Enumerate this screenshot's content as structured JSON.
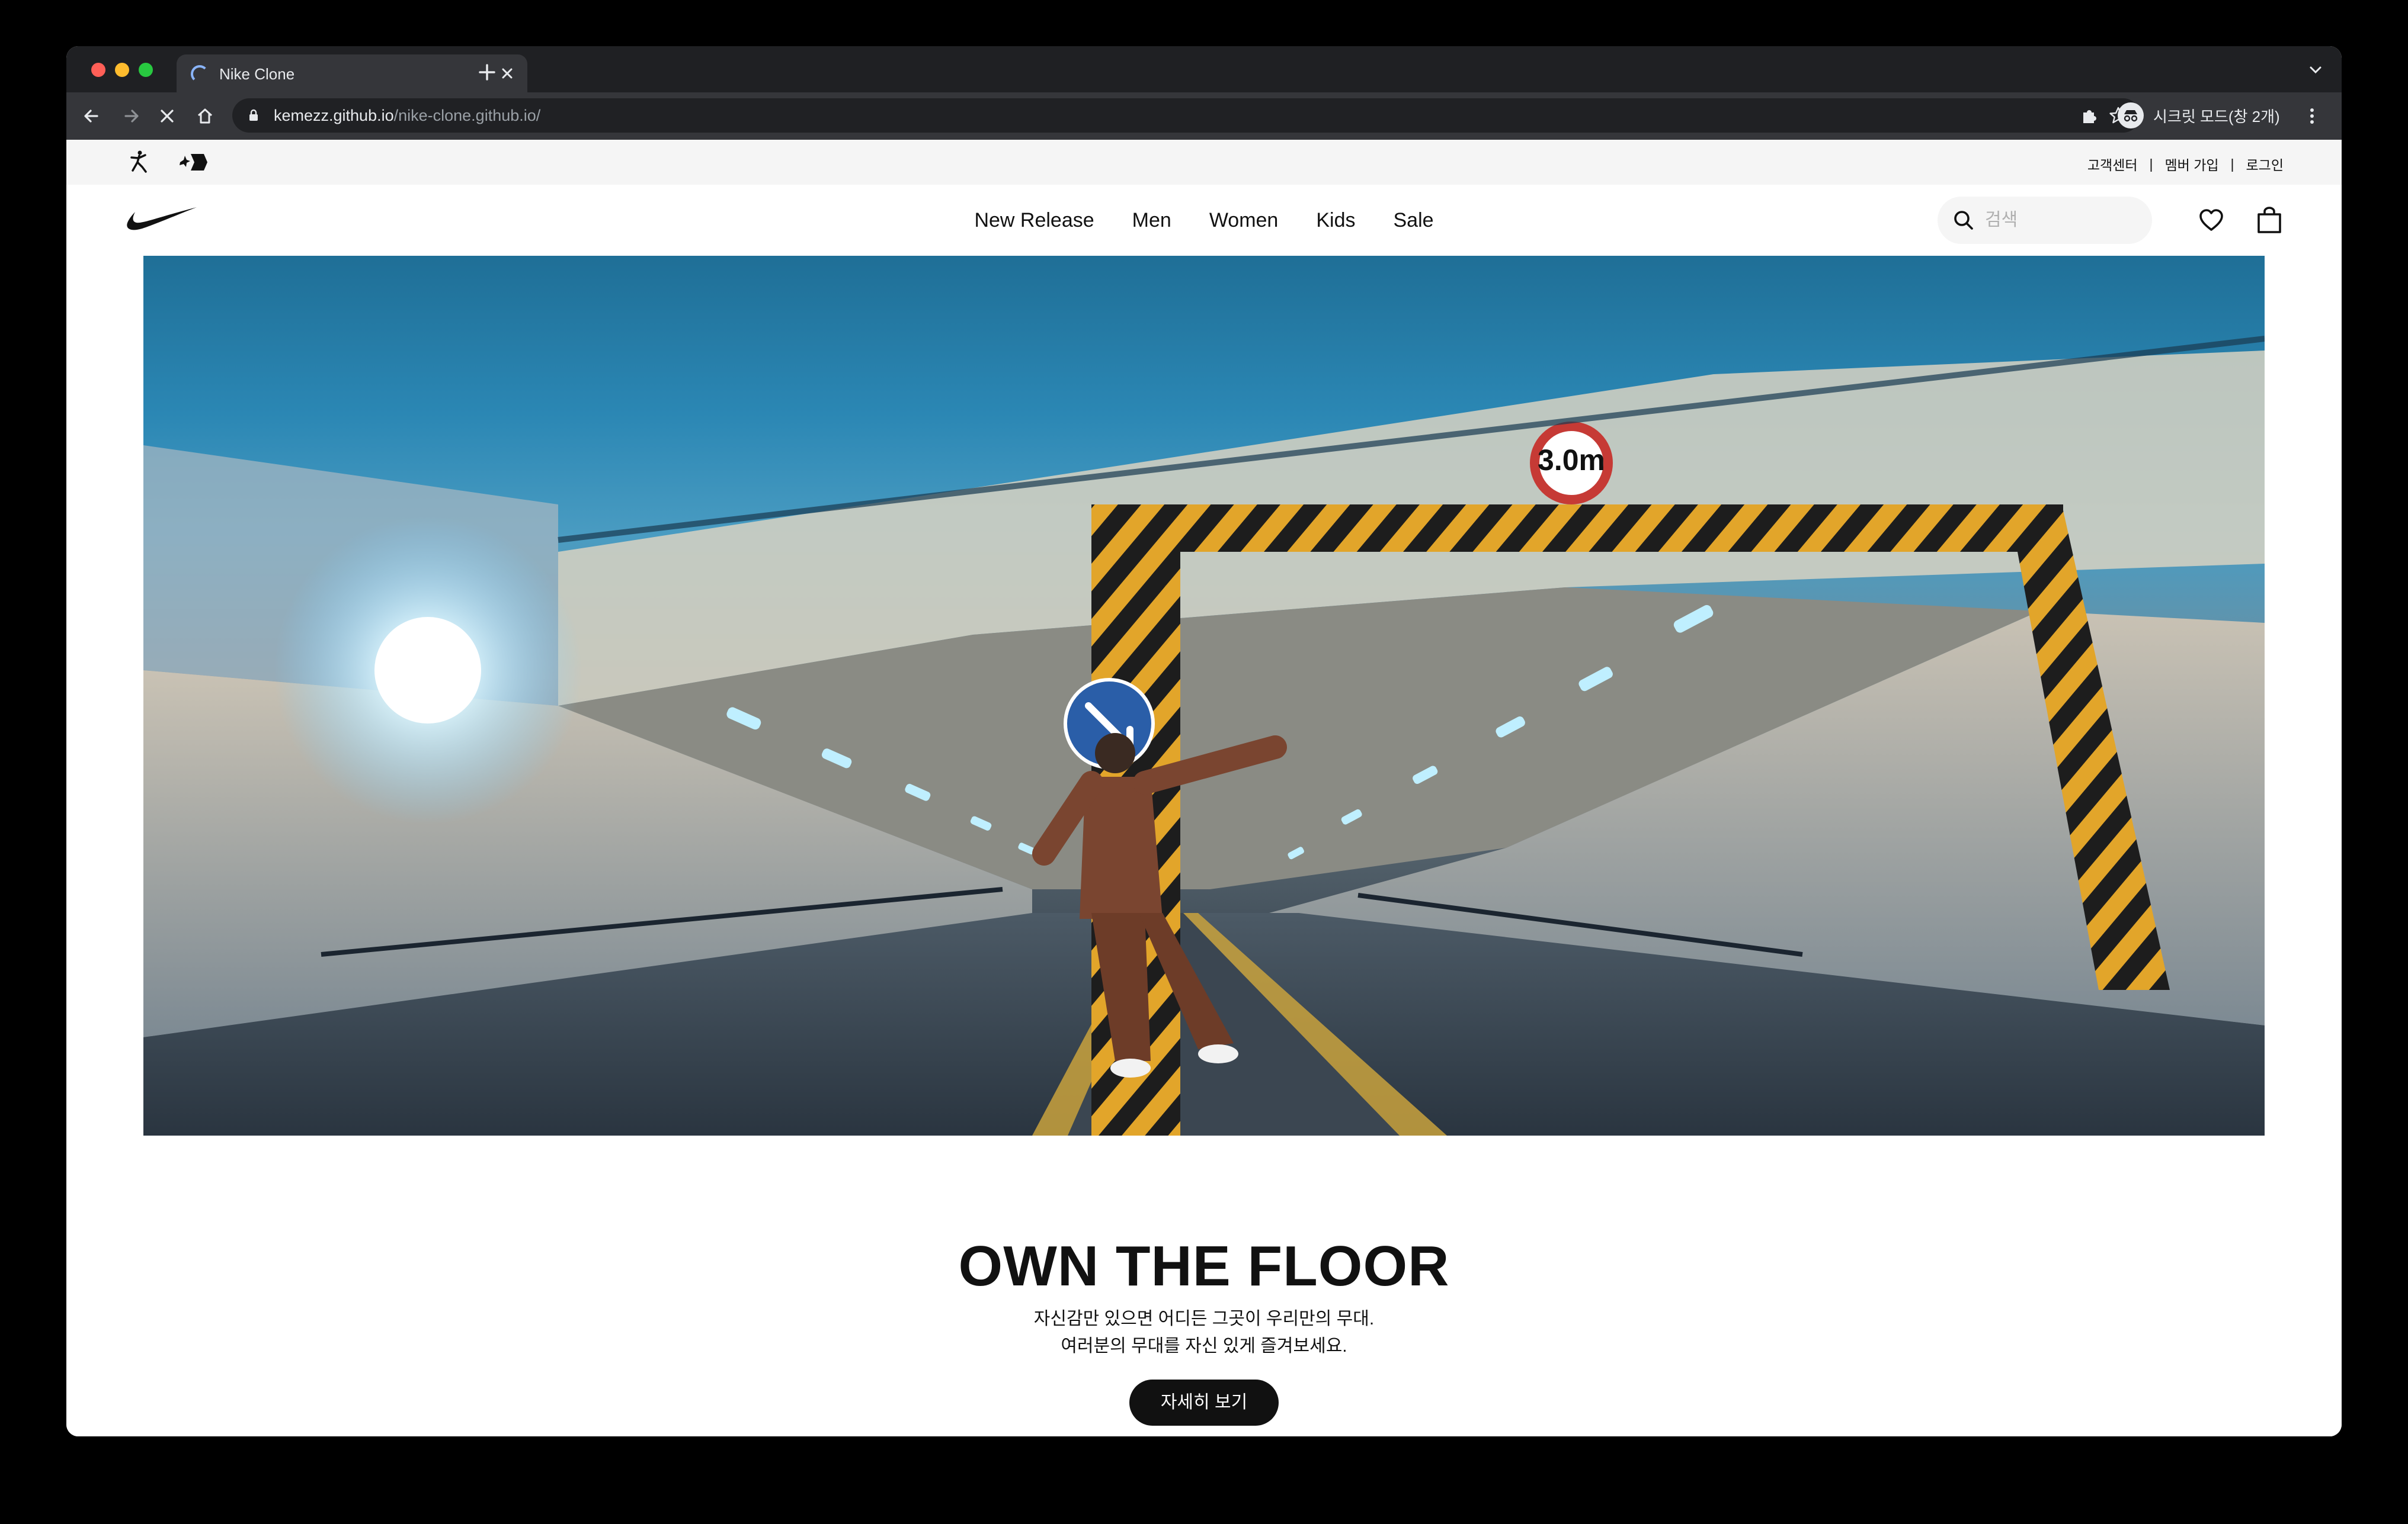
{
  "browser": {
    "tab_title": "Nike Clone",
    "url_host": "kemezz.github.io",
    "url_path": "/nike-clone.github.io/",
    "profile_label": "시크릿 모드(창 2개)"
  },
  "utility": {
    "links": [
      "고객센터",
      "멤버 가입",
      "로그인"
    ],
    "separator": "|"
  },
  "nav": {
    "menu": [
      "New Release",
      "Men",
      "Women",
      "Kids",
      "Sale"
    ],
    "search_placeholder": "검색"
  },
  "hero": {
    "title": "OWN THE FLOOR",
    "subtitle_line1": "자신감만 있으면 어디든 그곳이 우리만의 무대.",
    "subtitle_line2": "여러분의 무대를 자신 있게 즐겨보세요.",
    "cta_label": "자세히 보기"
  },
  "icons": {
    "tab_spinner": "loading-spinner-icon",
    "back": "arrow-left-icon",
    "forward": "arrow-right-icon",
    "stop": "close-icon",
    "home": "home-icon",
    "lock": "lock-icon",
    "bookmark": "star-icon",
    "extensions": "puzzle-icon",
    "menu": "vertical-dots-icon",
    "jordan": "jumpman-logo-icon",
    "converse": "converse-logo-icon",
    "nike": "swoosh-logo-icon",
    "search": "search-icon",
    "favorites": "heart-icon",
    "bag": "bag-icon"
  },
  "colors": {
    "browser_chrome": "#35363a",
    "tab_strip": "#1f2023",
    "page_bg": "#ffffff",
    "utility_bar": "#f5f5f5",
    "text": "#111111",
    "cta_bg": "#111111",
    "cta_text": "#ffffff"
  }
}
